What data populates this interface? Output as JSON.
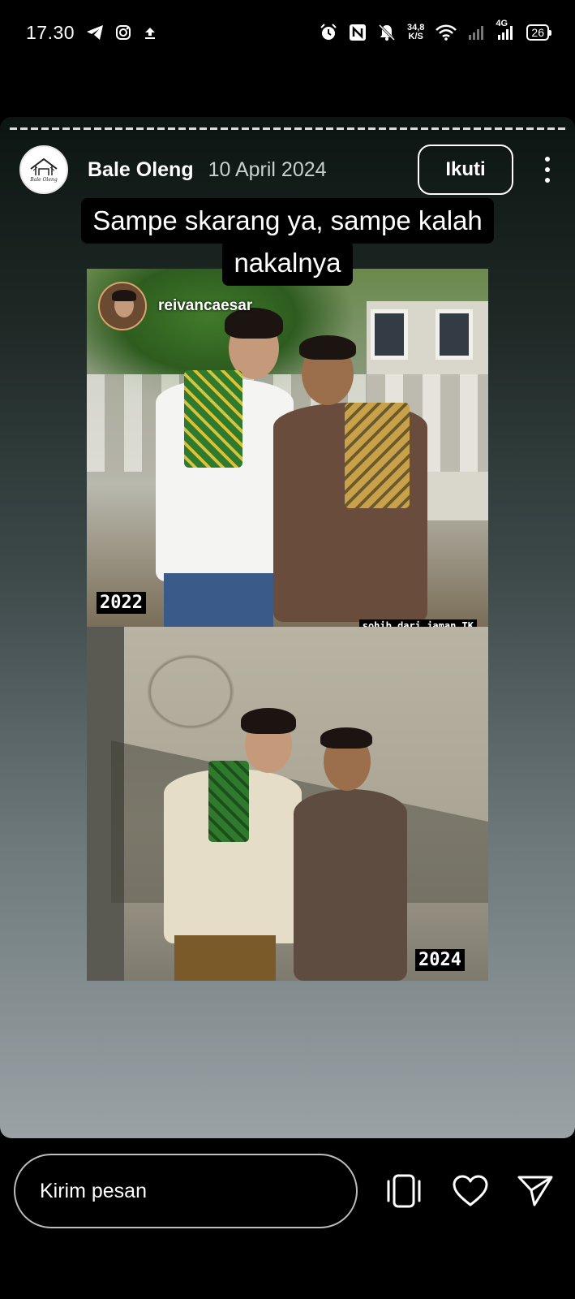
{
  "status_bar": {
    "time": "17.30",
    "net_speed_value": "34,8",
    "net_speed_unit": "K/S",
    "network_type": "4G",
    "battery": "26",
    "icons": [
      "telegram-icon",
      "instagram-icon",
      "upload-icon",
      "alarm-icon",
      "nfc-icon",
      "mute-icon",
      "wifi-icon",
      "signal-icon"
    ]
  },
  "story": {
    "username": "Bale Oleng",
    "avatar_logo_text": "Bale Oleng",
    "date": "10 April 2024",
    "follow_label": "Ikuti",
    "caption_lines": [
      "Sampe skarang ya, sampe kalah",
      "nakalnya"
    ],
    "mention": "reivancaesar",
    "year_top": "2022",
    "photo_label": "sohib dari jaman TK",
    "year_bottom": "2024"
  },
  "bottom_bar": {
    "message_placeholder": "Kirim pesan",
    "icons": [
      "flip-card-icon",
      "heart-icon",
      "send-icon"
    ]
  }
}
